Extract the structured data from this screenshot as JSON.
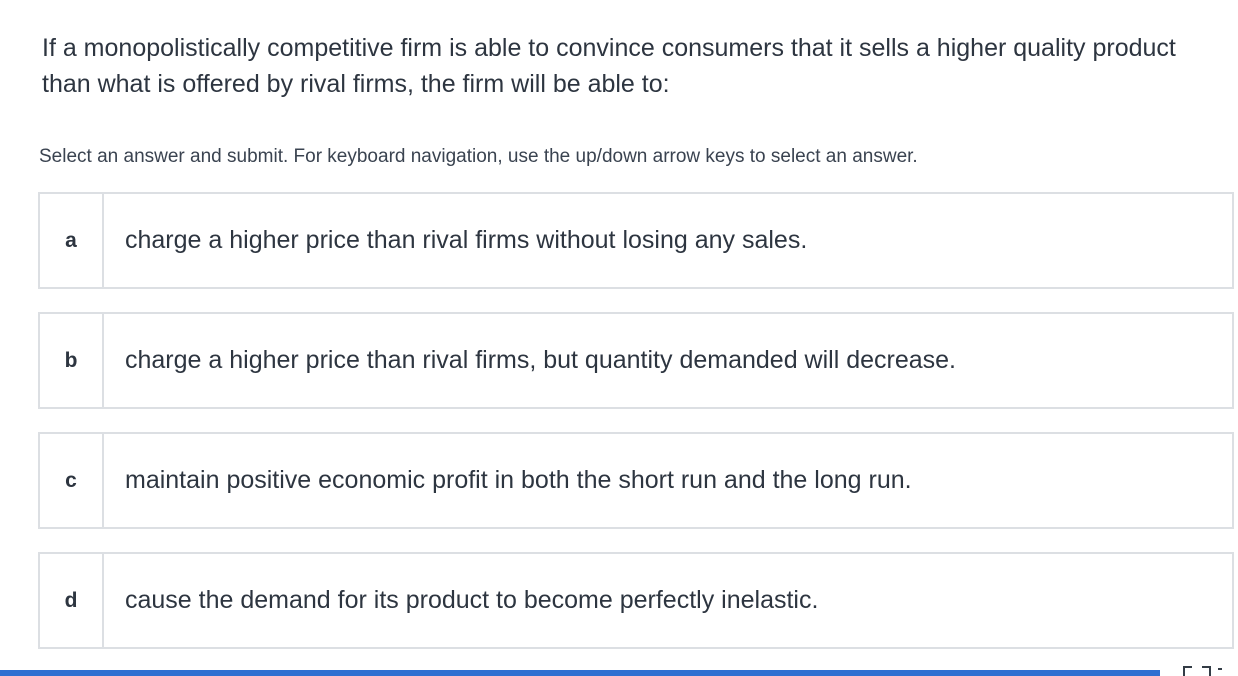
{
  "question": {
    "text": "If a monopolistically competitive firm is able to convince consumers that it sells a higher quality product than what is offered by rival firms, the firm will be able to:"
  },
  "instructions": "Select an answer and submit. For keyboard navigation, use the up/down arrow keys to select an answer.",
  "choices": [
    {
      "letter": "a",
      "text": "charge a higher price than rival firms without losing any sales."
    },
    {
      "letter": "b",
      "text": "charge a higher price than rival firms, but quantity demanded will decrease."
    },
    {
      "letter": "c",
      "text": "maintain positive economic profit in both the short run and the long run."
    },
    {
      "letter": "d",
      "text": "cause the demand for its product to become perfectly inelastic."
    }
  ],
  "icons": {
    "expand": "expand-icon"
  },
  "colors": {
    "accent": "#2f6fd1",
    "border": "#dcdfe3",
    "text": "#2d3540"
  }
}
